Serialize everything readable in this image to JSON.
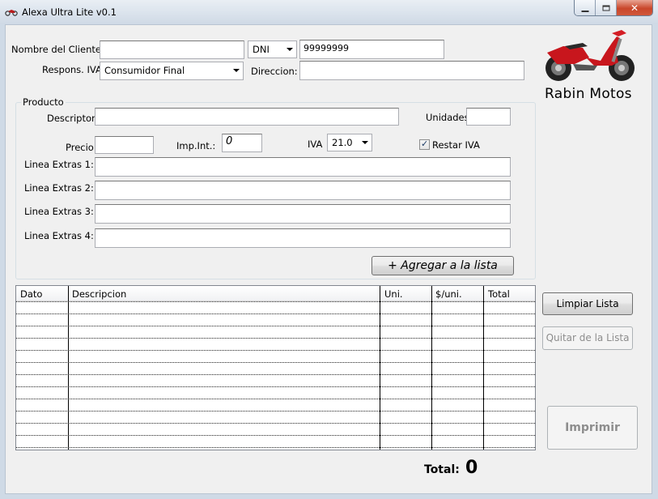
{
  "window": {
    "title": "Alexa Ultra Lite v0.1",
    "app_icon": "motorcycle-icon",
    "controls": [
      "minimize-icon",
      "maximize-icon",
      "close-icon"
    ]
  },
  "cliente": {
    "nombre_label": "Nombre del Cliente:",
    "nombre_value": "",
    "doc_type": "DNI",
    "doc_value": "99999999",
    "responsable_label": "Respons. IVA",
    "responsable_value": "Consumidor Final",
    "direccion_label": "Direccion:",
    "direccion_value": ""
  },
  "brand": {
    "name": "Rabin Motos",
    "logo": "motorcycle-image"
  },
  "producto": {
    "group_title": "Producto",
    "descriptor_label": "Descriptor",
    "descriptor_value": "",
    "unidades_label": "Unidades",
    "unidades_value": "",
    "precio_label": "Precio",
    "precio_value": "",
    "impint_label": "Imp.Int.:",
    "impint_value": "0",
    "iva_label": "IVA",
    "iva_value": "21.0",
    "restar_iva_label": "Restar IVA",
    "restar_iva_checked": true,
    "extras": [
      {
        "label": "Linea Extras 1:",
        "value": ""
      },
      {
        "label": "Linea Extras 2:",
        "value": ""
      },
      {
        "label": "Linea Extras 3:",
        "value": ""
      },
      {
        "label": "Linea Extras 4:",
        "value": ""
      }
    ],
    "agregar_label": "+ Agregar a la lista"
  },
  "table": {
    "columns": [
      "Dato",
      "Descripcion",
      "Uni.",
      "$/uni.",
      "Total"
    ],
    "rows": []
  },
  "actions": {
    "limpiar_label": "Limpiar Lista",
    "quitar_label": "Quitar de la Lista",
    "imprimir_label": "Imprimir"
  },
  "totals": {
    "total_label": "Total:",
    "total_value": "0"
  },
  "colors": {
    "close_button": "#c9472b",
    "window_bg": "#f0f0f0",
    "motorcycle_red": "#c8161d"
  }
}
